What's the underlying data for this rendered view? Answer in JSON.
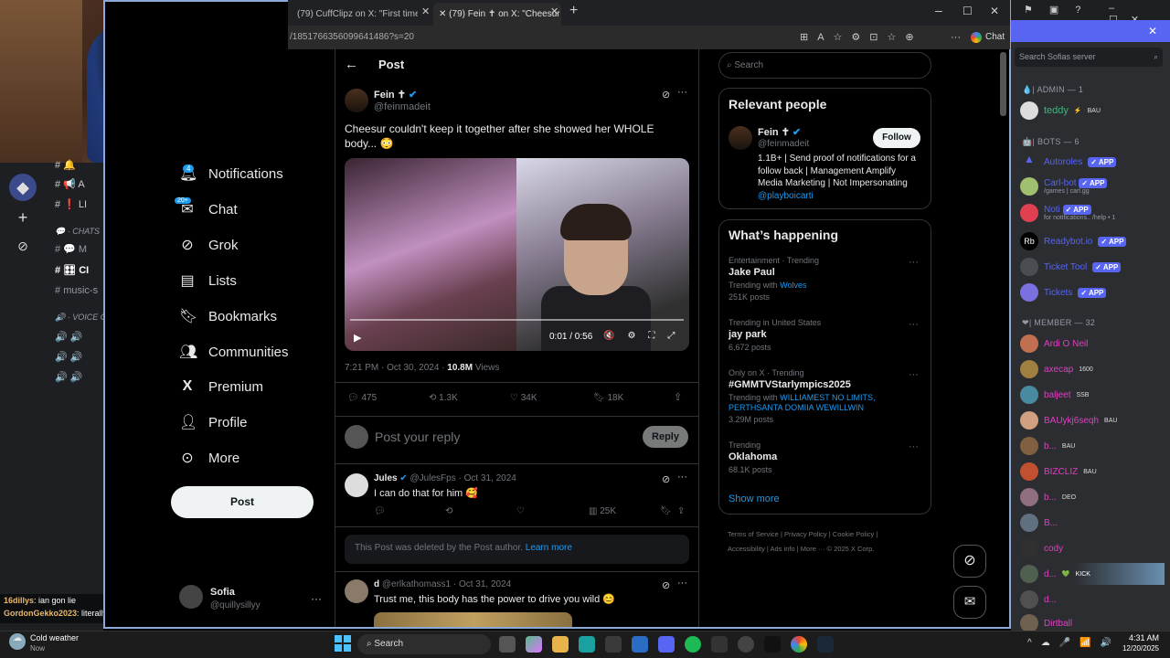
{
  "browser": {
    "tabs": [
      {
        "label": "(79) CuffClipz on X: \"First time Cuff"
      },
      {
        "label": "(79) Fein ✝ on X: \"Cheesur couldn'"
      }
    ],
    "url": "/1851766356099641486?s=20",
    "chat_label": "Chat"
  },
  "nav": {
    "items": [
      {
        "label": "Notifications",
        "icon": "bell-icon",
        "badge": "4"
      },
      {
        "label": "Chat",
        "icon": "mail-icon",
        "badge": "20+"
      },
      {
        "label": "Grok",
        "icon": "grok-icon"
      },
      {
        "label": "Lists",
        "icon": "list-icon"
      },
      {
        "label": "Bookmarks",
        "icon": "bookmark-icon"
      },
      {
        "label": "Communities",
        "icon": "communities-icon"
      },
      {
        "label": "Premium",
        "icon": "x-logo-icon"
      },
      {
        "label": "Profile",
        "icon": "person-icon"
      },
      {
        "label": "More",
        "icon": "more-circle-icon"
      }
    ],
    "post_button": "Post",
    "account": {
      "name": "Sofia",
      "handle": "@quillysillyy"
    }
  },
  "header": {
    "title": "Post"
  },
  "post": {
    "author": "Fein",
    "author_mark": "✝",
    "handle": "@feinmadeit",
    "text": "Cheesur couldn't keep it together after she showed her WHOLE body... 😳",
    "video_time": "0:01 / 0:56",
    "timestamp": "7:21 PM · Oct 30, 2024 · ",
    "views_count": "10.8M",
    "views_label": " Views",
    "replies": "475",
    "reposts": "1.3K",
    "likes": "34K",
    "bookmarks": "18K",
    "reply_placeholder": "Post your reply",
    "reply_button": "Reply"
  },
  "replies": [
    {
      "name": "Jules",
      "handle": "@JulesFps · Oct 31, 2024",
      "text": "I can do that for him 🥰",
      "views": "25K"
    },
    {
      "name": "d",
      "handle": "@erlkathomass1 · Oct 31, 2024",
      "text": "Trust me, this body has the power to drive you wild 😊"
    }
  ],
  "deleted_notice": {
    "text": "This Post was deleted by the Post author. ",
    "link": "Learn more"
  },
  "search": {
    "placeholder": "Search"
  },
  "relevant": {
    "title": "Relevant people",
    "name": "Fein",
    "name_mark": "✝",
    "handle": "@feinmadeit",
    "follow": "Follow",
    "bio": "1.1B+ | Send proof of notifications for a follow back | Management Amplify Media Marketing | Not Impersonating ",
    "bio_link": "@playboicarti"
  },
  "trending": {
    "title": "What’s happening",
    "items": [
      {
        "context": "Entertainment · Trending",
        "topic": "Jake Paul",
        "with_label": "Trending with ",
        "with": "Wolves",
        "count": "251K posts"
      },
      {
        "context": "Trending in United States",
        "topic": "jay park",
        "count": "6,672 posts"
      },
      {
        "context": "Only on X · Trending",
        "topic": "#GMMTVStarlympics2025",
        "with_label": "Trending with ",
        "with": "WILLIAMEST NO LIMITS, PERTHSANTA DOMIIA WEWILLWIN",
        "count": "3.29M posts"
      },
      {
        "context": "Trending",
        "topic": "Oklahoma",
        "count": "68.1K posts"
      }
    ],
    "show_more": "Show more"
  },
  "footer_links": [
    "Terms of Service",
    "Privacy Policy",
    "Cookie Policy",
    "Accessibility",
    "Ads info",
    "More ···",
    "© 2025 X Corp."
  ],
  "discord_left": {
    "section_chats": "CHATS",
    "section_voice": "VOICE C",
    "channel_music": "music-s"
  },
  "stream_chat": [
    {
      "user": "16dillys",
      "msg": ": ian gon lie"
    },
    {
      "user": "GordonGekko2023",
      "msg": ": literally a minor"
    }
  ],
  "discord_right": {
    "search_placeholder": "Search Sofias server",
    "groups": [
      {
        "label": "| ADMIN — 1"
      },
      {
        "label": "| BOTS — 6"
      },
      {
        "label": "| MEMBER — 32"
      }
    ],
    "admins": [
      {
        "name": "teddy",
        "tag": "BAU",
        "color": "#43b581"
      }
    ],
    "bots": [
      {
        "name": "Autoroles",
        "sub": "",
        "color": "#5865f2"
      },
      {
        "name": "Carl-bot",
        "sub": "/games | carl.gg",
        "color": "#5865f2"
      },
      {
        "name": "Noti",
        "sub": "for notifications.. /help • 1",
        "color": "#5865f2"
      },
      {
        "name": "Readybot.io",
        "sub": "",
        "color": "#5865f2"
      },
      {
        "name": "Ticket Tool",
        "sub": "",
        "color": "#5865f2"
      },
      {
        "name": "Tickets",
        "sub": "",
        "color": "#5865f2"
      }
    ],
    "app_tag": "APP",
    "members": [
      {
        "name": "Ardi O Neil",
        "tag": ""
      },
      {
        "name": "axecap",
        "tag": "1600"
      },
      {
        "name": "baljeet",
        "tag": "SSB"
      },
      {
        "name": "BAUykj6seqh",
        "tag": "BAU"
      },
      {
        "name": "b...",
        "tag": "BAU"
      },
      {
        "name": "BIZCLIZ",
        "tag": "BAU"
      },
      {
        "name": "b...",
        "tag": "DEO"
      },
      {
        "name": "B...",
        "tag": ""
      },
      {
        "name": "cody",
        "tag": ""
      },
      {
        "name": "d...",
        "tag": "KICK"
      },
      {
        "name": "d...",
        "tag": ""
      },
      {
        "name": "Dirtball",
        "tag": ""
      }
    ]
  },
  "taskbar": {
    "weather_title": "Cold weather",
    "weather_sub": "Now",
    "search": "Search",
    "time": "4:31 AM",
    "date": "12/20/2025"
  }
}
